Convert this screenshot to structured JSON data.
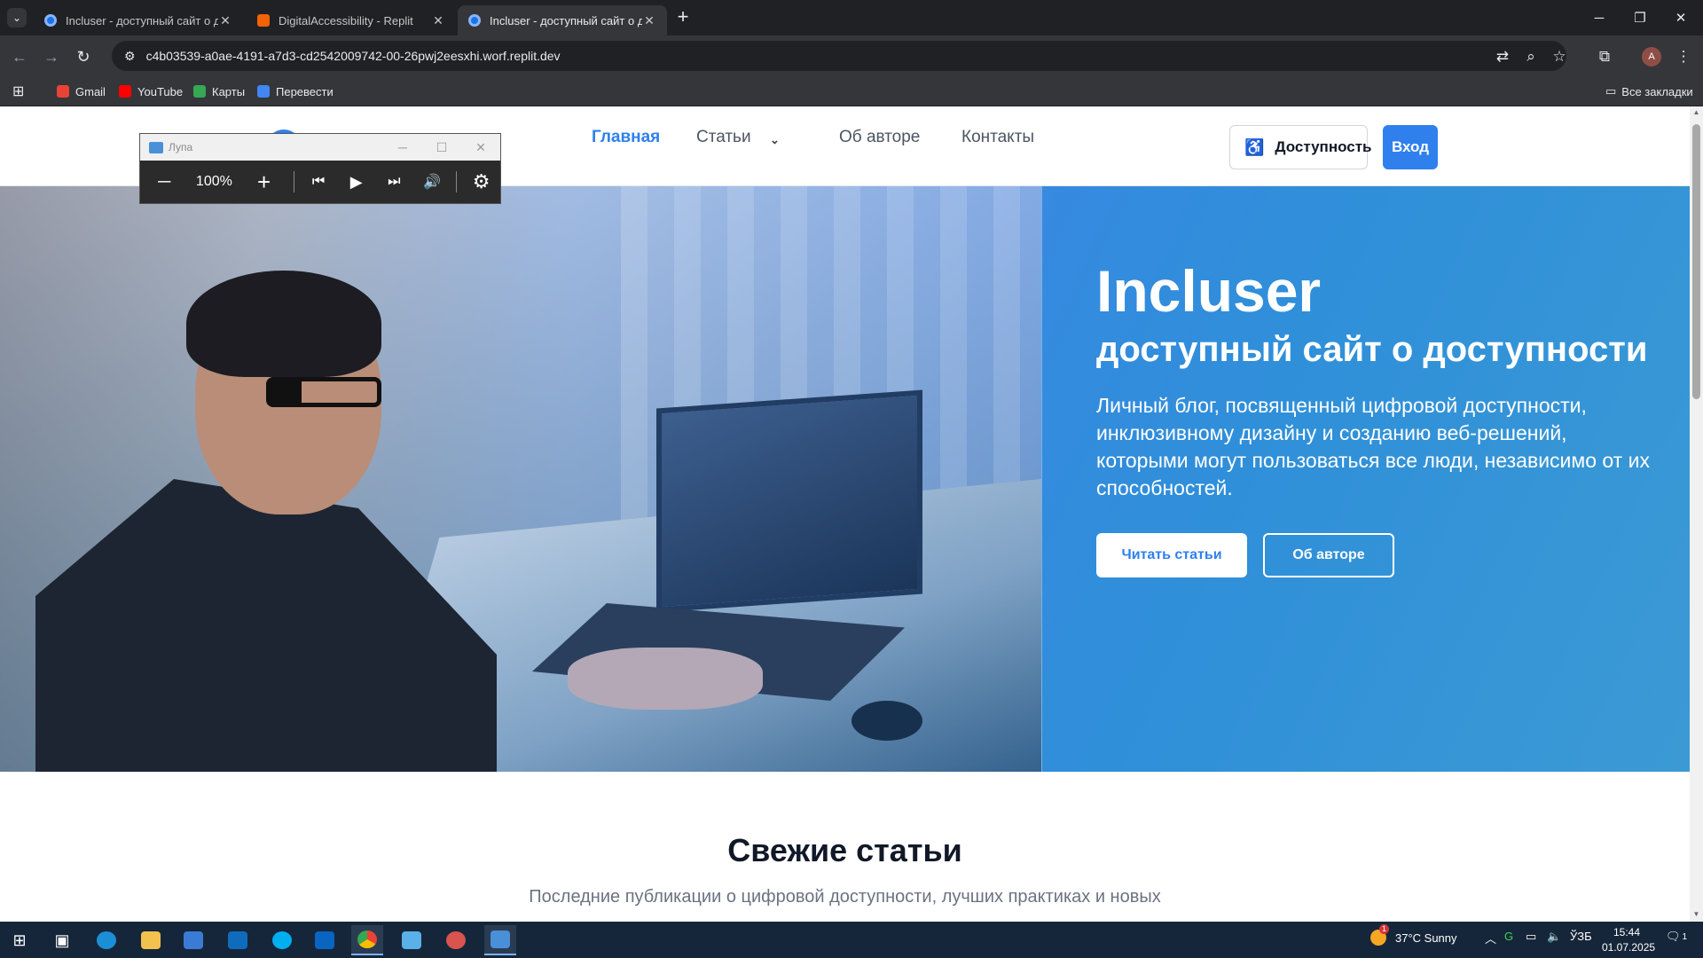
{
  "browser": {
    "tabs": [
      {
        "title": "Incluser - доступный сайт о до",
        "active": false
      },
      {
        "title": "DigitalAccessibility - Replit",
        "active": false
      },
      {
        "title": "Incluser - доступный сайт о до",
        "active": true
      }
    ],
    "url": "c4b03539-a0ae-4191-a7d3-cd2542009742-00-26pwj2eesxhi.worf.replit.dev",
    "profile_initial": "A",
    "bookmarks": [
      "Gmail",
      "YouTube",
      "Карты",
      "Перевести"
    ],
    "all_bookmarks": "Все закладки"
  },
  "site": {
    "nav": [
      "Главная",
      "Статьи",
      "Об авторе",
      "Контакты"
    ],
    "accessibility_button": "Доступность",
    "login_button": "Вход",
    "hero": {
      "title": "Incluser",
      "subtitle": "доступный сайт о доступности",
      "lead": "Личный блог, посвященный цифровой доступности, инклюзивному дизайну и созданию веб-решений, которыми могут пользоваться все люди, независимо от их способностей.",
      "primary_button": "Читать статьи",
      "secondary_button": "Об авторе"
    },
    "section": {
      "title": "Свежие статьи",
      "subtitle": "Последние публикации о цифровой доступности, лучших практиках и новых"
    }
  },
  "magnifier": {
    "title": "Лупа",
    "zoom": "100%"
  },
  "taskbar": {
    "weather": "37°C  Sunny",
    "weather_badge": "1",
    "lang": "ЎЗБ",
    "time": "15:44",
    "date": "01.07.2025",
    "notifications": "1"
  },
  "colors": {
    "accent": "#2f80ed",
    "chrome_bg": "#202124",
    "taskbar": "#16263a"
  }
}
